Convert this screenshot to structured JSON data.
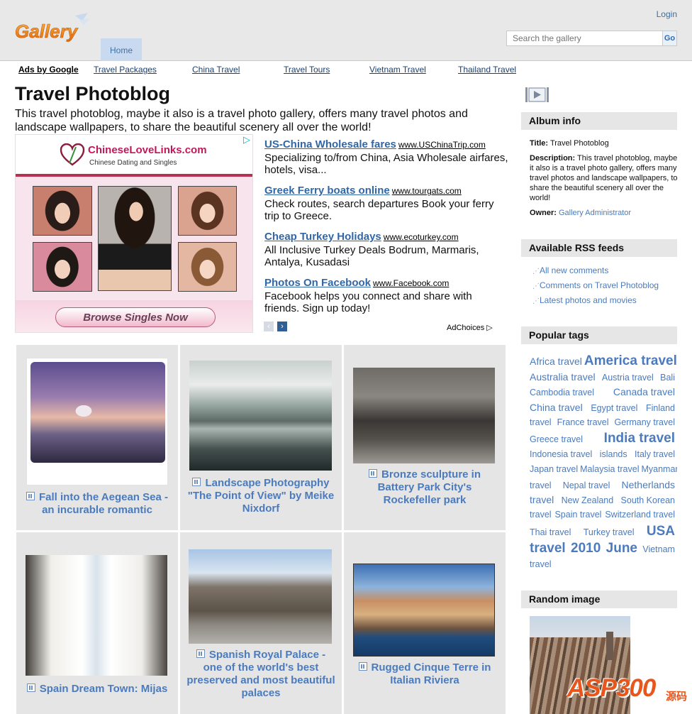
{
  "header": {
    "logo_text": "Gallery",
    "home_tab": "Home",
    "login": "Login",
    "search_placeholder": "Search the gallery",
    "search_button": "Go"
  },
  "linkbar": {
    "ads_label": "Ads by Google",
    "links": [
      "Travel Packages",
      "China Travel",
      "Travel Tours",
      "Vietnam Travel",
      "Thailand Travel"
    ]
  },
  "main": {
    "title": "Travel Photoblog",
    "description": "This travel photoblog, maybe it also is a travel photo gallery, offers many travel photos and landscape wallpapers, to share the beautiful scenery all over the world!"
  },
  "image_ad": {
    "brand": "ChineseLoveLinks.com",
    "tagline": "Chinese Dating and Singles",
    "cta": "Browse Singles Now"
  },
  "text_ads": [
    {
      "headline": "US-China Wholesale fares",
      "domain": "www.USChinaTrip.com",
      "body": "Specializing to/from China, Asia Wholesale airfares, hotels, visa..."
    },
    {
      "headline": "Greek Ferry boats online",
      "domain": "www.tourgats.com",
      "body": "Check routes, search departures Book your ferry trip to Greece."
    },
    {
      "headline": "Cheap Turkey Holidays",
      "domain": "www.ecoturkey.com",
      "body": "All Inclusive Turkey Deals Bodrum, Marmaris, Antalya, Kusadasi"
    },
    {
      "headline": "Photos On Facebook",
      "domain": "www.Facebook.com",
      "body": "Facebook helps you connect and share with friends. Sign up today!"
    }
  ],
  "ad_nav": {
    "prev": "‹",
    "next": "›",
    "adchoices": "AdChoices"
  },
  "albums": [
    {
      "title": "Fall into the Aegean Sea - an incurable romantic"
    },
    {
      "title": "Landscape Photography \"The Point of View\" by Meike Nixdorf"
    },
    {
      "title": "Bronze sculpture in Battery Park City's Rockefeller park"
    },
    {
      "title": "Spain Dream Town: Mijas"
    },
    {
      "title": "Spanish Royal Palace - one of the world's best preserved and most beautiful palaces"
    },
    {
      "title": "Rugged Cinque Terre in Italian Riviera"
    }
  ],
  "sidebar": {
    "album_info": {
      "heading": "Album info",
      "title_label": "Title:",
      "title_value": "Travel Photoblog",
      "description_label": "Description:",
      "description_value": "This travel photoblog, maybe it also is a travel photo gallery, offers many travel photos and landscape wallpapers, to share the beautiful scenery all over the world!",
      "owner_label": "Owner:",
      "owner_value": "Gallery Administrator"
    },
    "rss": {
      "heading": "Available RSS feeds",
      "items": [
        "All new comments",
        "Comments on Travel Photoblog",
        "Latest photos and movies"
      ]
    },
    "tags": {
      "heading": "Popular tags",
      "lines": [
        [
          {
            "t": "Africa travel",
            "s": "m"
          },
          {
            "t": "America travel",
            "s": "l"
          }
        ],
        [
          {
            "t": "Australia travel",
            "s": "m"
          },
          {
            "t": "Austria travel",
            "s": "s"
          },
          {
            "t": "Bali",
            "s": "s"
          }
        ],
        [
          {
            "t": "Cambodia travel",
            "s": "s"
          },
          {
            "t": "Canada travel",
            "s": "m"
          }
        ],
        [
          {
            "t": "China travel",
            "s": "m"
          },
          {
            "t": "Egypt travel",
            "s": "s"
          },
          {
            "t": "Finland",
            "s": "s"
          }
        ],
        [
          {
            "t": "travel",
            "s": "s"
          },
          {
            "t": "France travel",
            "s": "s"
          },
          {
            "t": "Germany travel",
            "s": "s"
          }
        ],
        [
          {
            "t": "Greece travel",
            "s": "s"
          },
          {
            "t": "India travel",
            "s": "l"
          }
        ],
        [
          {
            "t": "Indonesia travel",
            "s": "s"
          },
          {
            "t": "islands",
            "s": "s"
          },
          {
            "t": "Italy travel",
            "s": "s"
          }
        ],
        [
          {
            "t": "Japan travel",
            "s": "s"
          },
          {
            "t": "Malaysia travel",
            "s": "s"
          },
          {
            "t": "Myanmar",
            "s": "s"
          }
        ],
        [
          {
            "t": "travel",
            "s": "s"
          },
          {
            "t": "Nepal travel",
            "s": "s"
          },
          {
            "t": "Netherlands",
            "s": "m"
          }
        ],
        [
          {
            "t": "travel",
            "s": "m"
          },
          {
            "t": "New Zealand",
            "s": "s"
          },
          {
            "t": "South Korean",
            "s": "s"
          }
        ],
        [
          {
            "t": "travel",
            "s": "s"
          },
          {
            "t": "Spain travel",
            "s": "s"
          },
          {
            "t": "Switzerland travel",
            "s": "s"
          }
        ],
        [
          {
            "t": "Thai travel",
            "s": "s"
          },
          {
            "t": "Turkey travel",
            "s": "s"
          },
          {
            "t": "USA",
            "s": "l"
          }
        ],
        [
          {
            "t": "travel",
            "s": "l"
          },
          {
            "t": "2010",
            "s": "l"
          },
          {
            "t": "June",
            "s": "l"
          },
          {
            "t": "Vietnam",
            "s": "s"
          }
        ],
        [
          {
            "t": "travel",
            "s": "s"
          }
        ]
      ]
    },
    "random": {
      "heading": "Random image"
    }
  },
  "watermark": {
    "text": "ASP300",
    "cjk": "源码"
  },
  "colors": {
    "link": "#4b7bbd",
    "header_bg": "#e8e8e8",
    "tab_bg": "#c9d9ef",
    "box_title_bg": "#e6e6e6"
  }
}
